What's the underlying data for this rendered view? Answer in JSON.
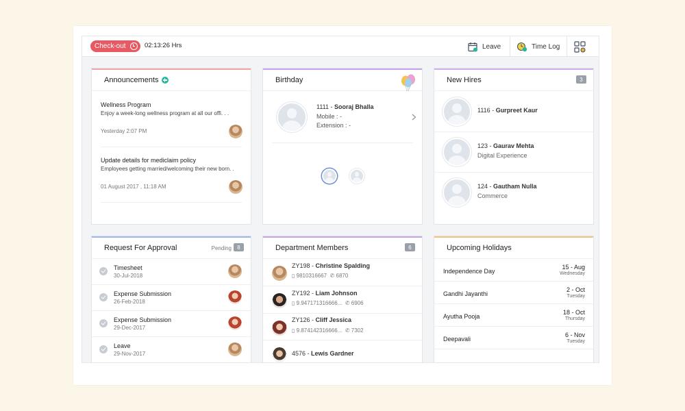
{
  "topbar": {
    "checkout_label": "Check-out",
    "timer": "02:13:26 Hrs",
    "leave_label": "Leave",
    "timelog_label": "Time Log"
  },
  "announcements": {
    "title": "Announcements",
    "items": [
      {
        "title": "Wellness Program",
        "desc": "Enjoy a week-long wellness program at all our offi. . .",
        "time": "Yesterday 2:07 PM"
      },
      {
        "title": "Update details for mediclaim policy",
        "desc": "Employees getting married/welcoming their new born. .",
        "time": "01 August 2017 , 11:18 AM"
      }
    ]
  },
  "birthday": {
    "title": "Birthday",
    "person": {
      "id": "1111",
      "name": "Sooraj Bhalla",
      "mobile": "Mobile : -",
      "extension": "Extension : -"
    }
  },
  "new_hires": {
    "title": "New Hires",
    "count": "3",
    "items": [
      {
        "id": "1116",
        "name": "Gurpreet Kaur",
        "dept": ""
      },
      {
        "id": "123",
        "name": "Gaurav Mehta",
        "dept": "Digital Experience"
      },
      {
        "id": "124",
        "name": "Gautham Nulla",
        "dept": "Commerce"
      }
    ]
  },
  "approval": {
    "title": "Request For Approval",
    "status": "Pending",
    "count": "8",
    "items": [
      {
        "title": "Timesheet",
        "date": "30-Jul-2018"
      },
      {
        "title": "Expense Submission",
        "date": "26-Feb-2018"
      },
      {
        "title": "Expense Submission",
        "date": "29-Dec-2017"
      },
      {
        "title": "Leave",
        "date": "29-Nov-2017"
      }
    ]
  },
  "department": {
    "title": "Department Members",
    "count": "6",
    "items": [
      {
        "id": "ZY198",
        "name": "Christine Spalding",
        "phone": "9810316667",
        "ext": "6870"
      },
      {
        "id": "ZY192",
        "name": "Liam Johnson",
        "phone": "9.947171316666...",
        "ext": "6906"
      },
      {
        "id": "ZY126",
        "name": "Cliff Jessica",
        "phone": "9.874142316666...",
        "ext": "7302"
      },
      {
        "id": "4576",
        "name": "Lewis Gardner",
        "phone": "",
        "ext": ""
      }
    ]
  },
  "holidays": {
    "title": "Upcoming Holidays",
    "items": [
      {
        "name": "Independence Day",
        "date": "15 - Aug",
        "day": "Wednesday"
      },
      {
        "name": "Gandhi Jayanthi",
        "date": "2 - Oct",
        "day": "Tuesday"
      },
      {
        "name": "Ayutha Pooja",
        "date": "18 - Oct",
        "day": "Thursday"
      },
      {
        "name": "Deepavali",
        "date": "6 - Nov",
        "day": "Tuesday"
      }
    ]
  },
  "colors": {
    "checkout": "#e85a63",
    "announcements_accent": "#f0a4a8",
    "birthday_accent": "#c9a3ea",
    "newhires_accent": "#cdb0ec",
    "approval_accent": "#9db6ec",
    "department_accent": "#c7a4e8",
    "holidays_accent": "#f3c27b"
  }
}
